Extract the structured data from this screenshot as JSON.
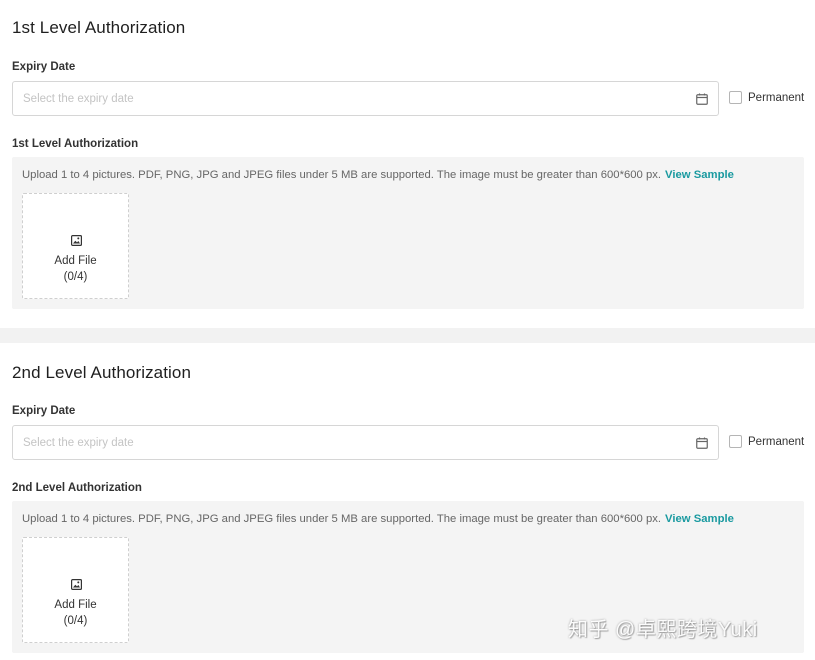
{
  "sections": [
    {
      "title": "1st Level Authorization",
      "expiry_label": "Expiry Date",
      "expiry_placeholder": "Select the expiry date",
      "permanent_label": "Permanent",
      "upload_label": "1st Level Authorization",
      "upload_info": "Upload 1 to 4 pictures. PDF, PNG, JPG and JPEG files under 5 MB are supported. The image must be greater than 600*600 px.",
      "view_sample": "View Sample",
      "add_file": "Add File",
      "file_count": "(0/4)"
    },
    {
      "title": "2nd Level Authorization",
      "expiry_label": "Expiry Date",
      "expiry_placeholder": "Select the expiry date",
      "permanent_label": "Permanent",
      "upload_label": "2nd Level Authorization",
      "upload_info": "Upload 1 to 4 pictures. PDF, PNG, JPG and JPEG files under 5 MB are supported. The image must be greater than 600*600 px.",
      "view_sample": "View Sample",
      "add_file": "Add File",
      "file_count": "(0/4)"
    }
  ],
  "icons": {
    "calendar": "calendar-icon",
    "image": "image-icon"
  },
  "colors": {
    "link": "#1a9aa0",
    "upload_bg": "#f4f4f4",
    "divider_bg": "#f2f2f2"
  },
  "watermark": "知乎 @卓熙跨境Yuki"
}
